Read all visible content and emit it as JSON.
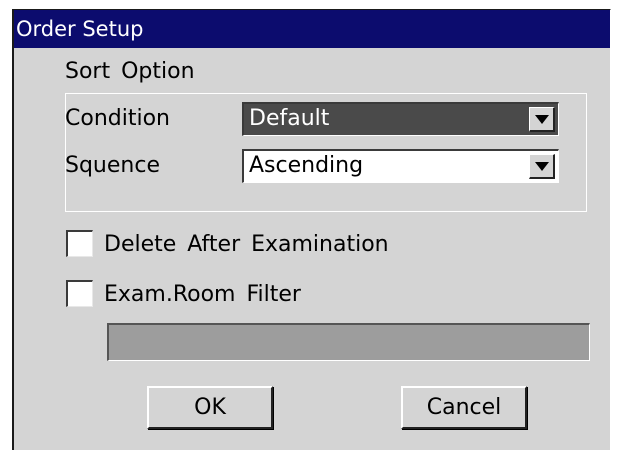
{
  "dialog": {
    "title": "Order Setup",
    "sort_group": {
      "label": "Sort Option",
      "condition": {
        "label": "Condition",
        "value": "Default"
      },
      "sequence": {
        "label": "Squence",
        "value": "Ascending"
      }
    },
    "delete_after_exam": {
      "label": "Delete After Examination",
      "checked": false
    },
    "exam_room_filter": {
      "label": "Exam.Room Filter",
      "checked": false,
      "value": ""
    },
    "buttons": {
      "ok": "OK",
      "cancel": "Cancel"
    }
  },
  "colors": {
    "titlebar": "#0c0c6e",
    "dialog_bg": "#d4d4d4",
    "selected_dropdown": "#4a4a4a",
    "disabled_field": "#9d9d9d"
  },
  "icons": {
    "dropdown_arrow": "triangle-down"
  }
}
